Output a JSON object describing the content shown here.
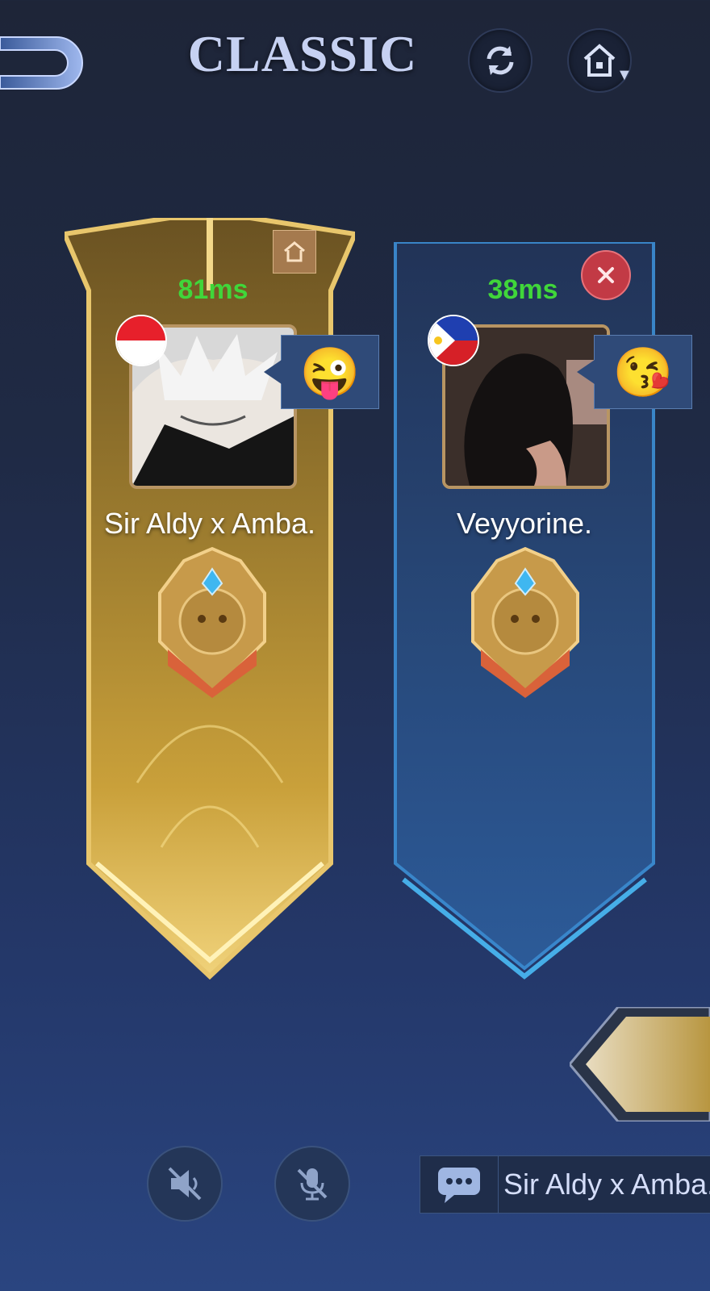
{
  "header": {
    "title": "CLASSIC"
  },
  "players": [
    {
      "name": "Sir Aldy x Amba.",
      "ping": "81ms",
      "emote": "😜",
      "flag": "indonesia-flag",
      "is_host": true
    },
    {
      "name": "Veyyorine.",
      "ping": "38ms",
      "emote": "😘",
      "flag": "philippines-flag",
      "is_host": false
    }
  ],
  "chat": {
    "last_message": "Sir Aldy x Amba."
  },
  "colors": {
    "ping": "#40d63a",
    "gold_banner": "#c9a03a",
    "blue_banner": "#2d5f9e",
    "kick": "#c23a45"
  }
}
